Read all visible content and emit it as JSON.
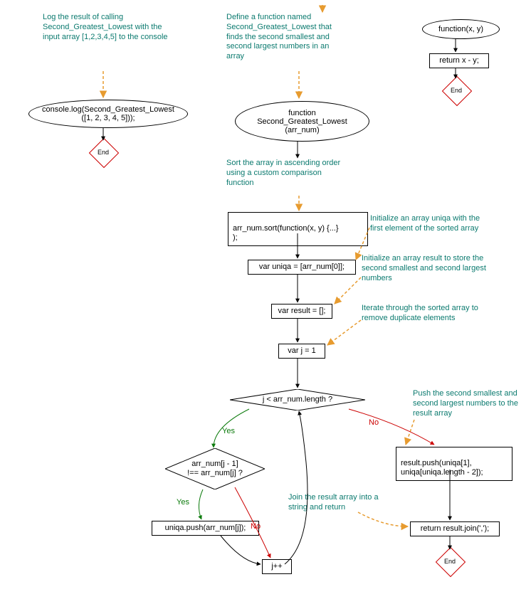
{
  "annotations": {
    "a1": "Log the result of calling Second_Greatest_Lowest with the input array [1,2,3,4,5] to the console",
    "a2": "Define a function named Second_Greatest_Lowest that finds the second smallest and second largest numbers in an array",
    "a3": "Sort the array in ascending order using a custom comparison function",
    "a4": "Initialize an array uniqa with the first element of the sorted array",
    "a5": "Initialize an array result to store the second smallest and second largest numbers",
    "a6": "Iterate through the sorted array to remove duplicate elements",
    "a7": "Push the second smallest and second largest numbers to the result array",
    "a8": "Join the result array into a string and return"
  },
  "nodes": {
    "logCall": "console.log(Second_Greatest_Lowest\n([1, 2, 3, 4, 5]));",
    "funcMain": "function\nSecond_Greatest_Lowest\n(arr_num)",
    "funcCmp": "function(x, y)",
    "returnXY": "return x - y;",
    "sortCall": "arr_num.sort(function(x, y) {...}\n);",
    "uniqa": "var uniqa = [arr_num[0]];",
    "result": "var result = [];",
    "varJ": "var j = 1",
    "cond1": "j < arr_num.length ?",
    "cond2": "arr_num[j - 1]\n!== arr_num[j] ?",
    "pushUniqa": "uniqa.push(arr_num[j]);",
    "jpp": "j++",
    "pushResult": "result.push(uniqa[1],\nuniqa[uniqa.length - 2]);",
    "returnJoin": "return result.join(',');",
    "end": "End"
  },
  "edge_labels": {
    "yes": "Yes",
    "no": "No"
  },
  "chart_data": {
    "type": "flowchart",
    "entries": [
      {
        "id": "logCall",
        "shape": "ellipse",
        "text": "console.log(Second_Greatest_Lowest([1, 2, 3, 4, 5]));",
        "annotation": "a1"
      },
      {
        "id": "endLog",
        "shape": "end"
      },
      {
        "id": "funcCmp",
        "shape": "ellipse",
        "text": "function(x, y)"
      },
      {
        "id": "returnXY",
        "shape": "process",
        "text": "return x - y;"
      },
      {
        "id": "endCmp",
        "shape": "end"
      },
      {
        "id": "funcMain",
        "shape": "ellipse",
        "text": "function Second_Greatest_Lowest(arr_num)",
        "annotation": "a2"
      },
      {
        "id": "sortCall",
        "shape": "process",
        "text": "arr_num.sort(function(x, y) {...});",
        "annotation": "a3"
      },
      {
        "id": "uniqa",
        "shape": "process",
        "text": "var uniqa = [arr_num[0]];",
        "annotation": "a4"
      },
      {
        "id": "result",
        "shape": "process",
        "text": "var result = [];",
        "annotation": "a5"
      },
      {
        "id": "varJ",
        "shape": "process",
        "text": "var j = 1",
        "annotation": "a6"
      },
      {
        "id": "cond1",
        "shape": "decision",
        "text": "j < arr_num.length ?"
      },
      {
        "id": "cond2",
        "shape": "decision",
        "text": "arr_num[j - 1] !== arr_num[j] ?"
      },
      {
        "id": "pushUniqa",
        "shape": "process",
        "text": "uniqa.push(arr_num[j]);"
      },
      {
        "id": "jpp",
        "shape": "process",
        "text": "j++"
      },
      {
        "id": "pushResult",
        "shape": "process",
        "text": "result.push(uniqa[1], uniqa[uniqa.length - 2]);",
        "annotation": "a7"
      },
      {
        "id": "returnJoin",
        "shape": "process",
        "text": "return result.join(',');",
        "annotation": "a8"
      },
      {
        "id": "endMain",
        "shape": "end"
      }
    ],
    "edges": [
      {
        "from": "annotation-a1",
        "to": "logCall",
        "style": "dashed-orange"
      },
      {
        "from": "logCall",
        "to": "endLog"
      },
      {
        "from": "funcCmp",
        "to": "returnXY"
      },
      {
        "from": "returnXY",
        "to": "endCmp"
      },
      {
        "from": "annotation-a2",
        "to": "funcMain",
        "style": "dashed-orange"
      },
      {
        "from": "funcMain",
        "to": "sortCall"
      },
      {
        "from": "annotation-a3",
        "to": "sortCall",
        "style": "dashed-orange"
      },
      {
        "from": "sortCall",
        "to": "uniqa"
      },
      {
        "from": "annotation-a4",
        "to": "uniqa",
        "style": "dashed-orange"
      },
      {
        "from": "uniqa",
        "to": "result"
      },
      {
        "from": "annotation-a5",
        "to": "result",
        "style": "dashed-orange"
      },
      {
        "from": "result",
        "to": "varJ"
      },
      {
        "from": "annotation-a6",
        "to": "varJ",
        "style": "dashed-orange"
      },
      {
        "from": "varJ",
        "to": "cond1"
      },
      {
        "from": "cond1",
        "to": "cond2",
        "label": "Yes",
        "color": "green"
      },
      {
        "from": "cond1",
        "to": "pushResult",
        "label": "No",
        "color": "red"
      },
      {
        "from": "annotation-a7",
        "to": "pushResult",
        "style": "dashed-orange"
      },
      {
        "from": "cond2",
        "to": "pushUniqa",
        "label": "Yes",
        "color": "green"
      },
      {
        "from": "cond2",
        "to": "jpp",
        "label": "No",
        "color": "red"
      },
      {
        "from": "pushUniqa",
        "to": "jpp"
      },
      {
        "from": "jpp",
        "to": "cond1",
        "style": "loop-back"
      },
      {
        "from": "pushResult",
        "to": "returnJoin"
      },
      {
        "from": "annotation-a8",
        "to": "returnJoin",
        "style": "dashed-orange"
      },
      {
        "from": "returnJoin",
        "to": "endMain"
      }
    ]
  }
}
